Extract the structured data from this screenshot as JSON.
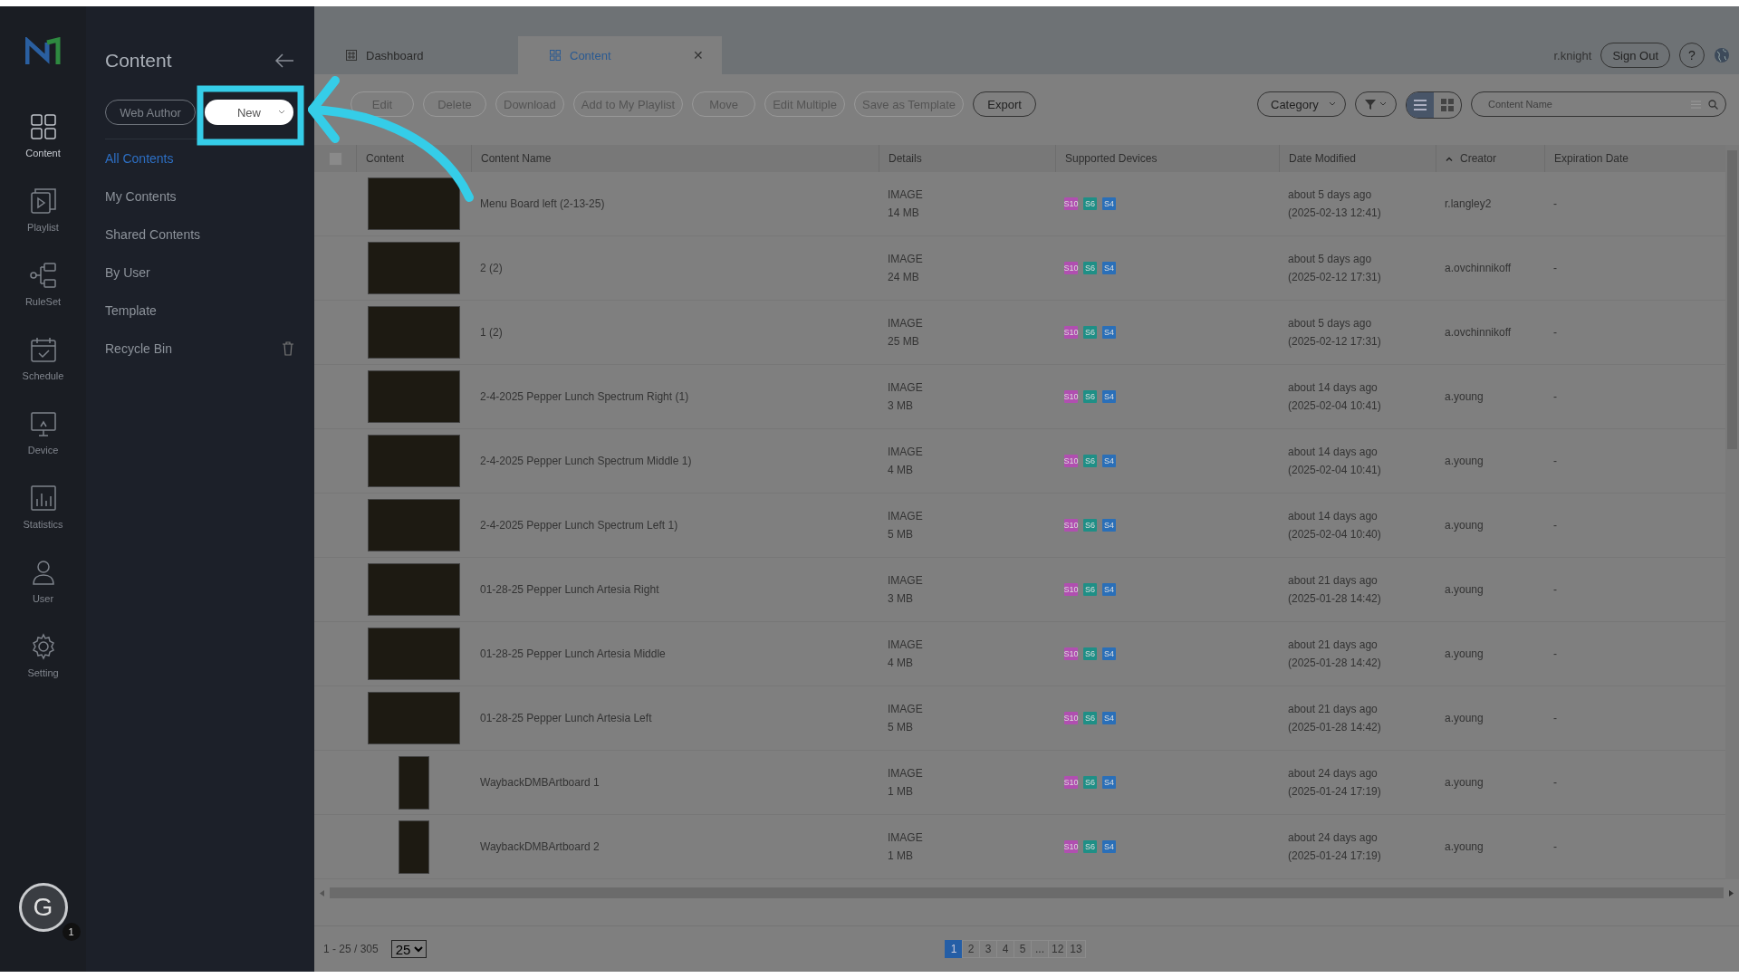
{
  "rail": [
    {
      "label": "Content",
      "selected": true
    },
    {
      "label": "Playlist",
      "selected": false
    },
    {
      "label": "RuleSet",
      "selected": false
    },
    {
      "label": "Schedule",
      "selected": false
    },
    {
      "label": "Device",
      "selected": false
    },
    {
      "label": "Statistics",
      "selected": false
    },
    {
      "label": "User",
      "selected": false
    },
    {
      "label": "Setting",
      "selected": false
    }
  ],
  "avatar": {
    "letter": "G",
    "badge": "1"
  },
  "nav": {
    "title": "Content",
    "web_author": "Web Author",
    "new_button": "New",
    "items": [
      {
        "label": "All Contents",
        "selected": true,
        "trash": false
      },
      {
        "label": "My Contents",
        "selected": false,
        "trash": false
      },
      {
        "label": "Shared Contents",
        "selected": false,
        "trash": false
      },
      {
        "label": "By User",
        "selected": false,
        "trash": false
      },
      {
        "label": "Template",
        "selected": false,
        "trash": false
      },
      {
        "label": "Recycle Bin",
        "selected": false,
        "trash": true
      }
    ]
  },
  "tabs": [
    {
      "label": "Dashboard",
      "selected": false
    },
    {
      "label": "Content",
      "selected": true,
      "close": "✕"
    }
  ],
  "header": {
    "user": "r.knight",
    "sign_out": "Sign Out",
    "help": "?"
  },
  "toolbar": [
    {
      "label": "Edit",
      "disabled": true
    },
    {
      "label": "Delete",
      "disabled": true
    },
    {
      "label": "Download",
      "disabled": true
    },
    {
      "label": "Add to My Playlist",
      "disabled": true
    },
    {
      "label": "Move",
      "disabled": true
    },
    {
      "label": "Edit Multiple",
      "disabled": true
    },
    {
      "label": "Save as Template",
      "disabled": true
    },
    {
      "label": "Export",
      "disabled": false
    }
  ],
  "filters": {
    "category": "Category",
    "search_placeholder": "Content Name",
    "views": [
      {
        "kind": "list",
        "selected": true
      },
      {
        "kind": "grid",
        "selected": false
      }
    ]
  },
  "table": {
    "columns": [
      "Content",
      "Content Name",
      "Details",
      "Supported Devices",
      "Date Modified",
      "Creator",
      "Expiration Date"
    ],
    "select_all": {
      "checked": false
    },
    "rows": [
      {
        "kind": "landscape",
        "name": "Menu Board left (2-13-25)",
        "type": "IMAGE",
        "size": "14 MB",
        "devices": [
          {
            "label": "S10",
            "color": "#b04fb0"
          },
          {
            "label": "S6",
            "color": "#1f8f86"
          },
          {
            "label": "S4",
            "color": "#2a6fb8"
          }
        ],
        "ago": "about 5 days ago",
        "date": "(2025-02-13 12:41)",
        "creator": "r.langley2",
        "expiration": "-"
      },
      {
        "kind": "landscape",
        "name": "2 (2)",
        "type": "IMAGE",
        "size": "24 MB",
        "devices": [
          {
            "label": "S10",
            "color": "#b04fb0"
          },
          {
            "label": "S6",
            "color": "#1f8f86"
          },
          {
            "label": "S4",
            "color": "#2a6fb8"
          }
        ],
        "ago": "about 5 days ago",
        "date": "(2025-02-12 17:31)",
        "creator": "a.ovchinnikoff",
        "expiration": "-"
      },
      {
        "kind": "landscape",
        "name": "1 (2)",
        "type": "IMAGE",
        "size": "25 MB",
        "devices": [
          {
            "label": "S10",
            "color": "#b04fb0"
          },
          {
            "label": "S6",
            "color": "#1f8f86"
          },
          {
            "label": "S4",
            "color": "#2a6fb8"
          }
        ],
        "ago": "about 5 days ago",
        "date": "(2025-02-12 17:31)",
        "creator": "a.ovchinnikoff",
        "expiration": "-"
      },
      {
        "kind": "landscape",
        "name": "2-4-2025 Pepper Lunch Spectrum Right (1)",
        "type": "IMAGE",
        "size": "3 MB",
        "devices": [
          {
            "label": "S10",
            "color": "#b04fb0"
          },
          {
            "label": "S6",
            "color": "#1f8f86"
          },
          {
            "label": "S4",
            "color": "#2a6fb8"
          }
        ],
        "ago": "about 14 days ago",
        "date": "(2025-02-04 10:41)",
        "creator": "a.young",
        "expiration": "-"
      },
      {
        "kind": "landscape",
        "name": "2-4-2025 Pepper Lunch Spectrum Middle 1)",
        "type": "IMAGE",
        "size": "4 MB",
        "devices": [
          {
            "label": "S10",
            "color": "#b04fb0"
          },
          {
            "label": "S6",
            "color": "#1f8f86"
          },
          {
            "label": "S4",
            "color": "#2a6fb8"
          }
        ],
        "ago": "about 14 days ago",
        "date": "(2025-02-04 10:41)",
        "creator": "a.young",
        "expiration": "-"
      },
      {
        "kind": "landscape",
        "name": "2-4-2025 Pepper Lunch Spectrum Left 1)",
        "type": "IMAGE",
        "size": "5 MB",
        "devices": [
          {
            "label": "S10",
            "color": "#b04fb0"
          },
          {
            "label": "S6",
            "color": "#1f8f86"
          },
          {
            "label": "S4",
            "color": "#2a6fb8"
          }
        ],
        "ago": "about 14 days ago",
        "date": "(2025-02-04 10:40)",
        "creator": "a.young",
        "expiration": "-"
      },
      {
        "kind": "landscape",
        "name": "01-28-25 Pepper Lunch Artesia Right",
        "type": "IMAGE",
        "size": "3 MB",
        "devices": [
          {
            "label": "S10",
            "color": "#b04fb0"
          },
          {
            "label": "S6",
            "color": "#1f8f86"
          },
          {
            "label": "S4",
            "color": "#2a6fb8"
          }
        ],
        "ago": "about 21 days ago",
        "date": "(2025-01-28 14:42)",
        "creator": "a.young",
        "expiration": "-"
      },
      {
        "kind": "landscape",
        "name": "01-28-25 Pepper Lunch Artesia Middle",
        "type": "IMAGE",
        "size": "4 MB",
        "devices": [
          {
            "label": "S10",
            "color": "#b04fb0"
          },
          {
            "label": "S6",
            "color": "#1f8f86"
          },
          {
            "label": "S4",
            "color": "#2a6fb8"
          }
        ],
        "ago": "about 21 days ago",
        "date": "(2025-01-28 14:42)",
        "creator": "a.young",
        "expiration": "-"
      },
      {
        "kind": "landscape",
        "name": "01-28-25 Pepper Lunch Artesia Left",
        "type": "IMAGE",
        "size": "5 MB",
        "devices": [
          {
            "label": "S10",
            "color": "#b04fb0"
          },
          {
            "label": "S6",
            "color": "#1f8f86"
          },
          {
            "label": "S4",
            "color": "#2a6fb8"
          }
        ],
        "ago": "about 21 days ago",
        "date": "(2025-01-28 14:42)",
        "creator": "a.young",
        "expiration": "-"
      },
      {
        "kind": "portrait",
        "name": "WaybackDMBArtboard 1",
        "type": "IMAGE",
        "size": "1 MB",
        "devices": [
          {
            "label": "S10",
            "color": "#b04fb0"
          },
          {
            "label": "S6",
            "color": "#1f8f86"
          },
          {
            "label": "S4",
            "color": "#2a6fb8"
          }
        ],
        "ago": "about 24 days ago",
        "date": "(2025-01-24 17:19)",
        "creator": "a.young",
        "expiration": "-"
      },
      {
        "kind": "portrait",
        "name": "WaybackDMBArtboard 2",
        "type": "IMAGE",
        "size": "1 MB",
        "devices": [
          {
            "label": "S10",
            "color": "#b04fb0"
          },
          {
            "label": "S6",
            "color": "#1f8f86"
          },
          {
            "label": "S4",
            "color": "#2a6fb8"
          }
        ],
        "ago": "about 24 days ago",
        "date": "(2025-01-24 17:19)",
        "creator": "a.young",
        "expiration": "-"
      }
    ]
  },
  "footer": {
    "range": "1 - 25 / 305",
    "per_page": "25",
    "pages": [
      {
        "label": "1",
        "selected": true
      },
      {
        "label": "2",
        "selected": false
      },
      {
        "label": "3",
        "selected": false
      },
      {
        "label": "4",
        "selected": false
      },
      {
        "label": "5",
        "selected": false
      },
      {
        "label": "...",
        "selected": false
      },
      {
        "label": "12",
        "selected": false
      },
      {
        "label": "13",
        "selected": false
      }
    ]
  }
}
